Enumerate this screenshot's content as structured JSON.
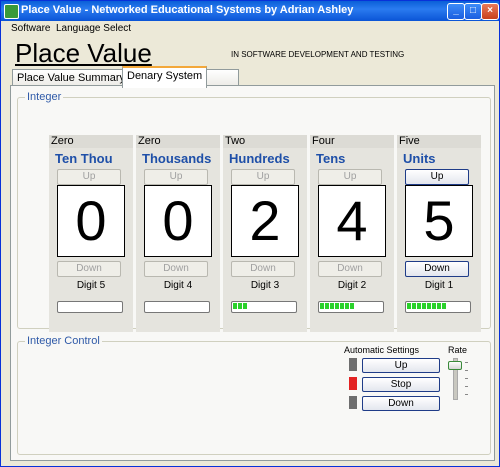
{
  "window": {
    "title": "Place Value - Networked Educational Systems by Adrian Ashley"
  },
  "menu": [
    "Software",
    "Language Select"
  ],
  "app": {
    "title": "Place Value",
    "subtitle": "IN SOFTWARE DEVELOPMENT AND TESTING"
  },
  "tabs": [
    {
      "label": "Place Value Summary",
      "active": false
    },
    {
      "label": "Denary System",
      "active": true
    },
    {
      "label": "",
      "active": false
    }
  ],
  "integer_group": {
    "label": "Integer",
    "up_label": "Up",
    "down_label": "Down",
    "columns": [
      {
        "word": "Zero",
        "place": "Ten Thou",
        "digit": "0",
        "name": "Digit 5",
        "meter_segments": 0,
        "enabled": false
      },
      {
        "word": "Zero",
        "place": "Thousands",
        "digit": "0",
        "name": "Digit 4",
        "meter_segments": 0,
        "enabled": false
      },
      {
        "word": "Two",
        "place": "Hundreds",
        "digit": "2",
        "name": "Digit 3",
        "meter_segments": 3,
        "enabled": false
      },
      {
        "word": "Four",
        "place": "Tens",
        "digit": "4",
        "name": "Digit 2",
        "meter_segments": 7,
        "enabled": false
      },
      {
        "word": "Five",
        "place": "Units",
        "digit": "5",
        "name": "Digit 1",
        "meter_segments": 8,
        "enabled": true
      }
    ]
  },
  "control_group": {
    "label": "Integer Control",
    "automatic_label": "Automatic Settings",
    "rate_label": "Rate",
    "buttons": [
      "Up",
      "Stop",
      "Down"
    ]
  },
  "colors": {
    "accent_blue": "#1e4fa8",
    "meter_green": "#2ad12a",
    "stop_red": "#e32222"
  }
}
